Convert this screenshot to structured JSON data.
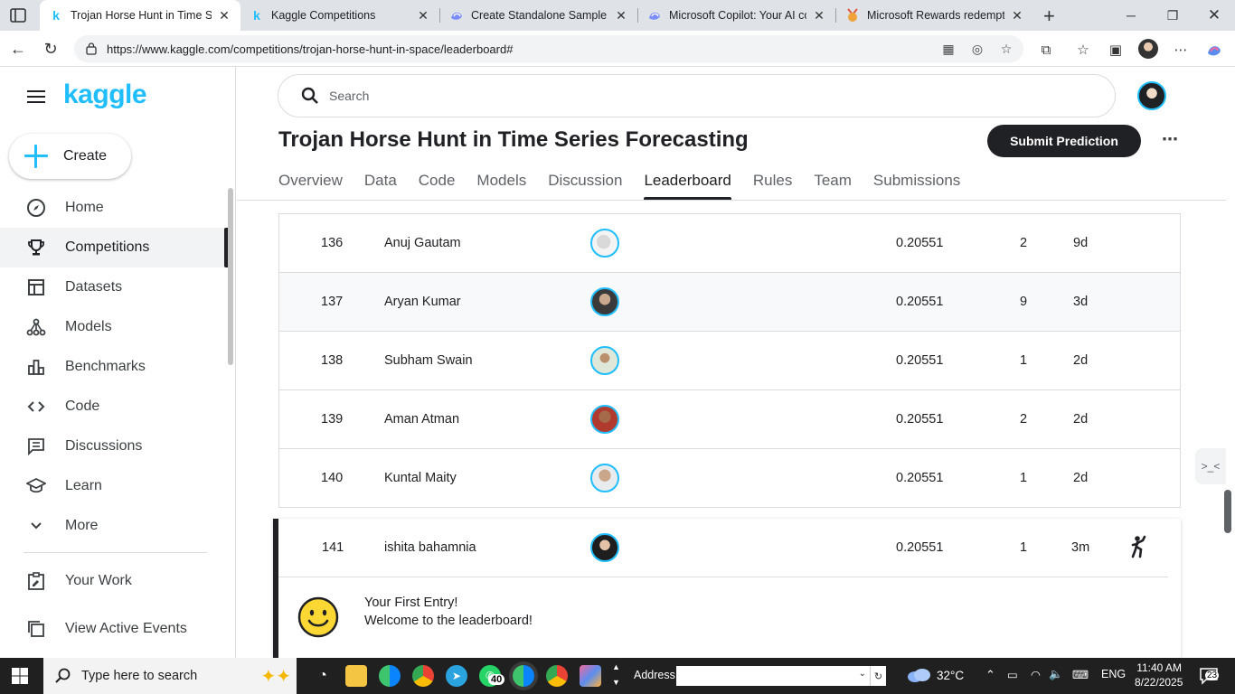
{
  "browser": {
    "tabs": [
      {
        "title": "Trojan Horse Hunt in Time Ser",
        "favicon": "kaggle-k",
        "active": true
      },
      {
        "title": "Kaggle Competitions",
        "favicon": "kaggle-k",
        "active": false
      },
      {
        "title": "Create Standalone Sample Sub",
        "favicon": "copilot",
        "active": false
      },
      {
        "title": "Microsoft Copilot: Your AI cor",
        "favicon": "copilot",
        "active": false
      },
      {
        "title": "Microsoft Rewards redemption",
        "favicon": "rewards-medal",
        "active": false
      }
    ],
    "url": "https://www.kaggle.com/competitions/trojan-horse-hunt-in-space/leaderboard#"
  },
  "sidebar": {
    "logo": "kaggle",
    "create_label": "Create",
    "items": [
      {
        "label": "Home",
        "icon": "compass-icon"
      },
      {
        "label": "Competitions",
        "icon": "trophy-icon",
        "selected": true
      },
      {
        "label": "Datasets",
        "icon": "table-icon"
      },
      {
        "label": "Models",
        "icon": "models-icon"
      },
      {
        "label": "Benchmarks",
        "icon": "benchmarks-icon"
      },
      {
        "label": "Code",
        "icon": "code-icon"
      },
      {
        "label": "Discussions",
        "icon": "discussion-icon"
      },
      {
        "label": "Learn",
        "icon": "learn-icon"
      },
      {
        "label": "More",
        "icon": "chevron-down-icon"
      }
    ],
    "secondary": [
      {
        "label": "Your Work",
        "icon": "your-work-icon"
      },
      {
        "label": "View Active Events",
        "icon": "events-icon"
      }
    ]
  },
  "header": {
    "search_placeholder": "Search",
    "competition_title": "Trojan Horse Hunt in Time Series Forecasting",
    "submit_label": "Submit Prediction",
    "tabs": [
      "Overview",
      "Data",
      "Code",
      "Models",
      "Discussion",
      "Leaderboard",
      "Rules",
      "Team",
      "Submissions"
    ],
    "active_tab": "Leaderboard"
  },
  "leaderboard": {
    "rows": [
      {
        "rank": "136",
        "name": "Anuj Gautam",
        "score": "0.20551",
        "entries": "2",
        "last": "9d"
      },
      {
        "rank": "137",
        "name": "Aryan Kumar",
        "score": "0.20551",
        "entries": "9",
        "last": "3d"
      },
      {
        "rank": "138",
        "name": "Subham Swain",
        "score": "0.20551",
        "entries": "1",
        "last": "2d"
      },
      {
        "rank": "139",
        "name": "Aman Atman",
        "score": "0.20551",
        "entries": "2",
        "last": "2d"
      },
      {
        "rank": "140",
        "name": "Kuntal Maity",
        "score": "0.20551",
        "entries": "1",
        "last": "2d"
      }
    ],
    "my_entry": {
      "rank": "141",
      "name": "ishita bahamnia",
      "score": "0.20551",
      "entries": "1",
      "last": "3m"
    },
    "welcome_line1": "Your First Entry!",
    "welcome_line2": "Welcome to the leaderboard!"
  },
  "taskbar": {
    "search_placeholder": "Type here to search",
    "whatsapp_badge": "40",
    "address_label": "Address",
    "temperature": "32°C",
    "language": "ENG",
    "time": "11:40 AM",
    "date": "8/22/2025",
    "notification_count": "23"
  },
  "colors": {
    "kaggle_blue": "#20beff",
    "dark": "#202124",
    "taskbar": "#202020"
  }
}
